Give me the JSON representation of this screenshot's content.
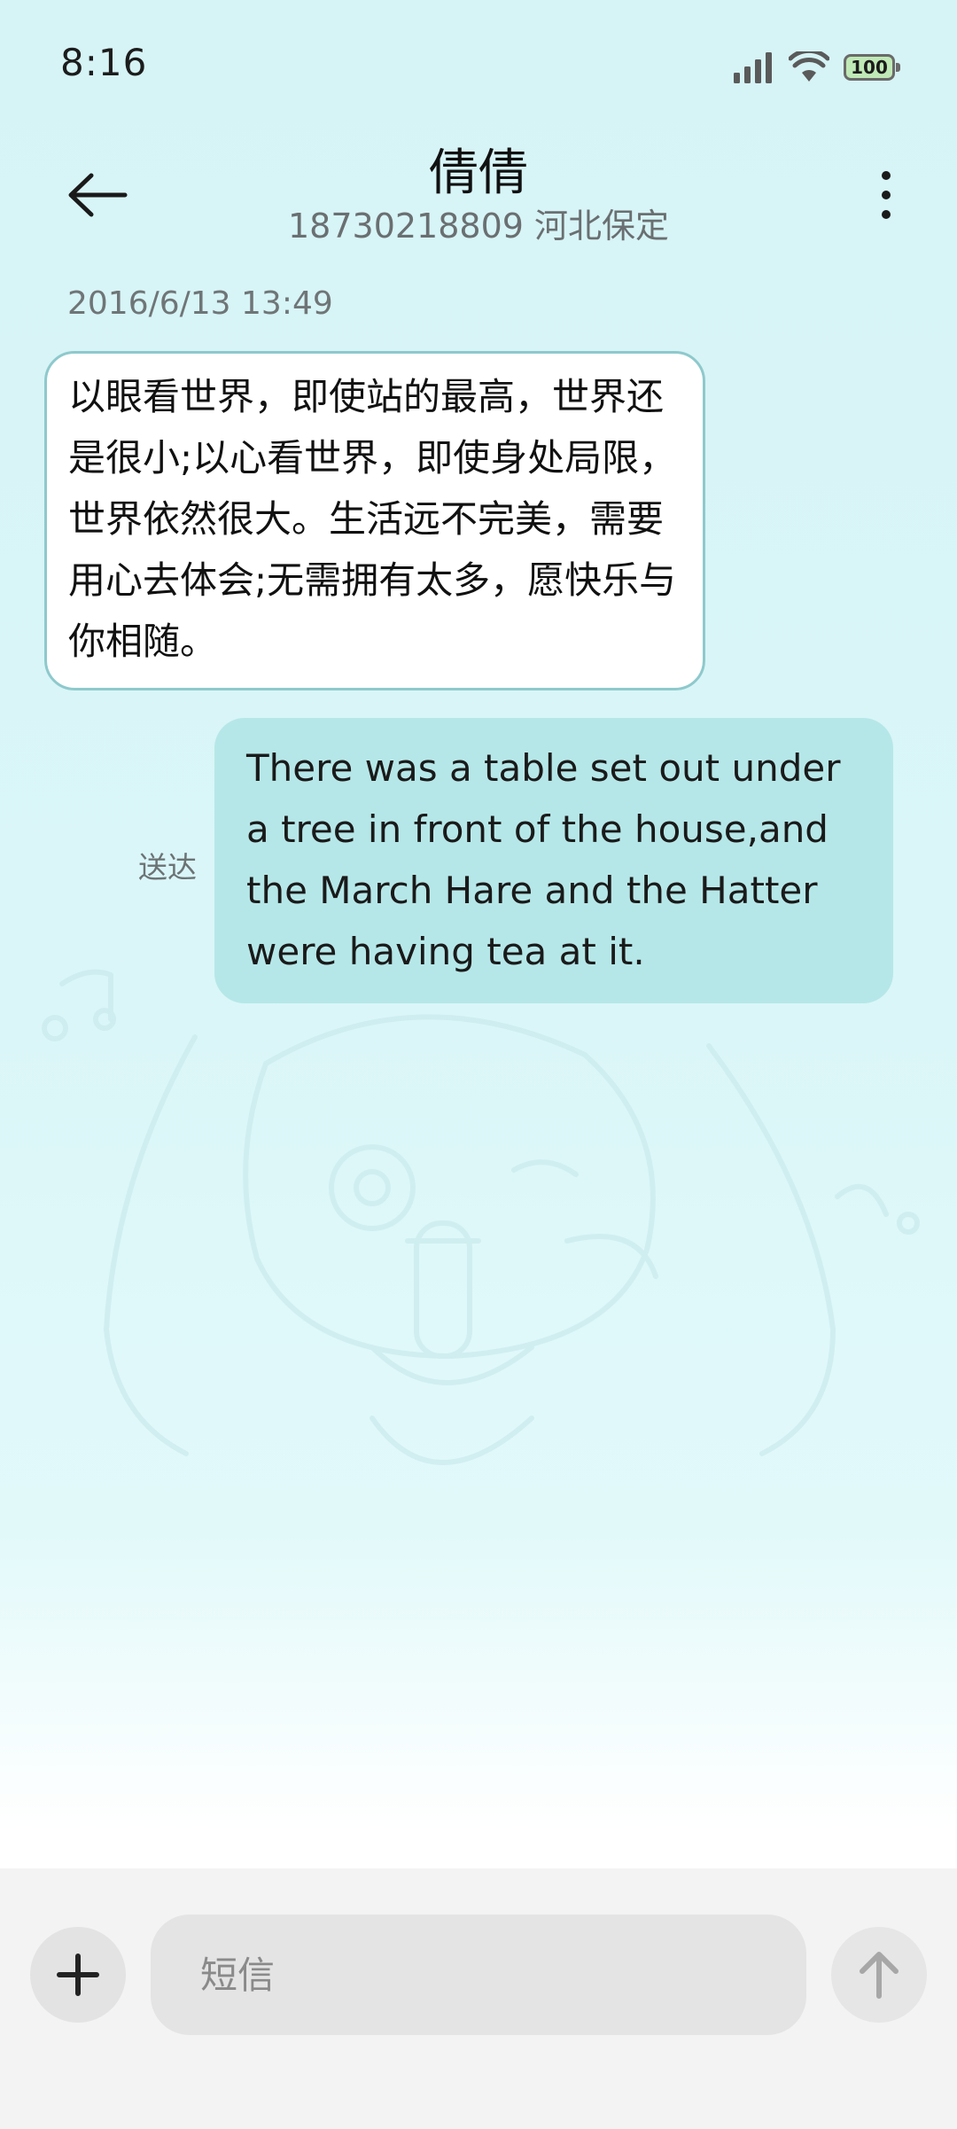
{
  "status_bar": {
    "time": "8:16",
    "battery": "100",
    "icons": [
      "signal-icon",
      "wifi-icon",
      "battery-icon"
    ]
  },
  "header": {
    "contact_name": "倩倩",
    "contact_detail": "18730218809 河北保定",
    "back_icon": "arrow-left-icon",
    "more_icon": "more-vertical-icon"
  },
  "conversation": {
    "timestamp": "2016/6/13 13:49",
    "messages": [
      {
        "direction": "incoming",
        "text": "以眼看世界，即使站的最高，世界还是很小;以心看世界，即使身处局限，世界依然很大。生活远不完美，需要用心去体会;无需拥有太多，愿快乐与你相随。"
      },
      {
        "direction": "outgoing",
        "text": "There was a table set out under a tree in front of the house,and the March Hare and the Hatter were having tea at it.",
        "status": "送达"
      }
    ]
  },
  "composer": {
    "placeholder": "短信",
    "value": "",
    "attach_icon": "plus-icon",
    "send_icon": "arrow-up-icon"
  },
  "colors": {
    "background": "#d6f3f5",
    "incoming_bubble": "#ffffff",
    "incoming_border": "#8ec9cc",
    "outgoing_bubble": "#b6e7e8",
    "composer_bar": "#f3f3f3"
  }
}
